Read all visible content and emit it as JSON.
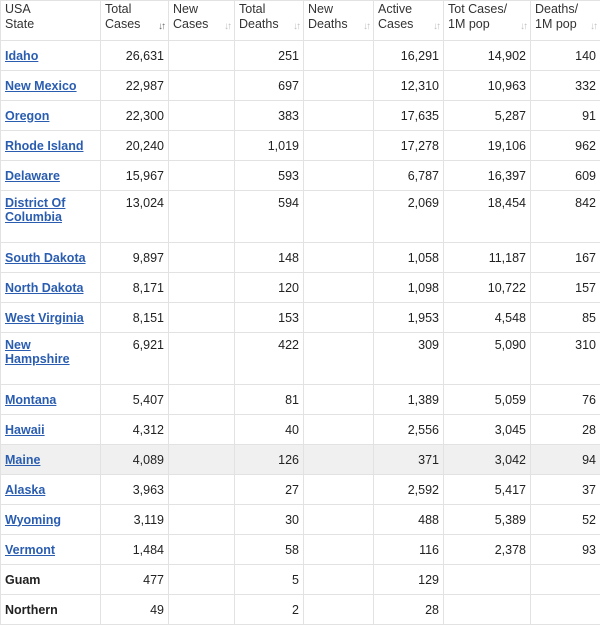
{
  "header": {
    "columns": [
      {
        "label1": "USA",
        "label2": "State",
        "sort": ""
      },
      {
        "label1": "Total",
        "label2": "Cases",
        "sort": "↓↑"
      },
      {
        "label1": "New",
        "label2": "Cases",
        "sort": "↓↑"
      },
      {
        "label1": "Total",
        "label2": "Deaths",
        "sort": "↓↑"
      },
      {
        "label1": "New",
        "label2": "Deaths",
        "sort": "↓↑"
      },
      {
        "label1": "Active",
        "label2": "Cases",
        "sort": "↓↑"
      },
      {
        "label1": "Tot Cases/",
        "label2": "1M pop",
        "sort": "↓↑"
      },
      {
        "label1": "Deaths/",
        "label2": "1M pop",
        "sort": "↓↑"
      }
    ]
  },
  "rows": [
    {
      "state": "Idaho",
      "total_cases": "26,631",
      "new_cases": "",
      "total_deaths": "251",
      "new_deaths": "",
      "active_cases": "16,291",
      "cases_per_m": "14,902",
      "deaths_per_m": "140"
    },
    {
      "state": "New Mexico",
      "total_cases": "22,987",
      "new_cases": "",
      "total_deaths": "697",
      "new_deaths": "",
      "active_cases": "12,310",
      "cases_per_m": "10,963",
      "deaths_per_m": "332"
    },
    {
      "state": "Oregon",
      "total_cases": "22,300",
      "new_cases": "",
      "total_deaths": "383",
      "new_deaths": "",
      "active_cases": "17,635",
      "cases_per_m": "5,287",
      "deaths_per_m": "91"
    },
    {
      "state": "Rhode Island",
      "total_cases": "20,240",
      "new_cases": "",
      "total_deaths": "1,019",
      "new_deaths": "",
      "active_cases": "17,278",
      "cases_per_m": "19,106",
      "deaths_per_m": "962"
    },
    {
      "state": "Delaware",
      "total_cases": "15,967",
      "new_cases": "",
      "total_deaths": "593",
      "new_deaths": "",
      "active_cases": "6,787",
      "cases_per_m": "16,397",
      "deaths_per_m": "609"
    },
    {
      "state": "District Of Columbia",
      "total_cases": "13,024",
      "new_cases": "",
      "total_deaths": "594",
      "new_deaths": "",
      "active_cases": "2,069",
      "cases_per_m": "18,454",
      "deaths_per_m": "842"
    },
    {
      "state": "South Dakota",
      "total_cases": "9,897",
      "new_cases": "",
      "total_deaths": "148",
      "new_deaths": "",
      "active_cases": "1,058",
      "cases_per_m": "11,187",
      "deaths_per_m": "167"
    },
    {
      "state": "North Dakota",
      "total_cases": "8,171",
      "new_cases": "",
      "total_deaths": "120",
      "new_deaths": "",
      "active_cases": "1,098",
      "cases_per_m": "10,722",
      "deaths_per_m": "157"
    },
    {
      "state": "West Virginia",
      "total_cases": "8,151",
      "new_cases": "",
      "total_deaths": "153",
      "new_deaths": "",
      "active_cases": "1,953",
      "cases_per_m": "4,548",
      "deaths_per_m": "85"
    },
    {
      "state": "New Hampshire",
      "total_cases": "6,921",
      "new_cases": "",
      "total_deaths": "422",
      "new_deaths": "",
      "active_cases": "309",
      "cases_per_m": "5,090",
      "deaths_per_m": "310"
    },
    {
      "state": "Montana",
      "total_cases": "5,407",
      "new_cases": "",
      "total_deaths": "81",
      "new_deaths": "",
      "active_cases": "1,389",
      "cases_per_m": "5,059",
      "deaths_per_m": "76"
    },
    {
      "state": "Hawaii",
      "total_cases": "4,312",
      "new_cases": "",
      "total_deaths": "40",
      "new_deaths": "",
      "active_cases": "2,556",
      "cases_per_m": "3,045",
      "deaths_per_m": "28"
    },
    {
      "state": "Maine",
      "total_cases": "4,089",
      "new_cases": "",
      "total_deaths": "126",
      "new_deaths": "",
      "active_cases": "371",
      "cases_per_m": "3,042",
      "deaths_per_m": "94"
    },
    {
      "state": "Alaska",
      "total_cases": "3,963",
      "new_cases": "",
      "total_deaths": "27",
      "new_deaths": "",
      "active_cases": "2,592",
      "cases_per_m": "5,417",
      "deaths_per_m": "37"
    },
    {
      "state": "Wyoming",
      "total_cases": "3,119",
      "new_cases": "",
      "total_deaths": "30",
      "new_deaths": "",
      "active_cases": "488",
      "cases_per_m": "5,389",
      "deaths_per_m": "52"
    },
    {
      "state": "Vermont",
      "total_cases": "1,484",
      "new_cases": "",
      "total_deaths": "58",
      "new_deaths": "",
      "active_cases": "116",
      "cases_per_m": "2,378",
      "deaths_per_m": "93"
    },
    {
      "state": "Guam",
      "total_cases": "477",
      "new_cases": "",
      "total_deaths": "5",
      "new_deaths": "",
      "active_cases": "129",
      "cases_per_m": "",
      "deaths_per_m": ""
    },
    {
      "state": "Northern",
      "total_cases": "49",
      "new_cases": "",
      "total_deaths": "2",
      "new_deaths": "",
      "active_cases": "28",
      "cases_per_m": "",
      "deaths_per_m": ""
    }
  ]
}
